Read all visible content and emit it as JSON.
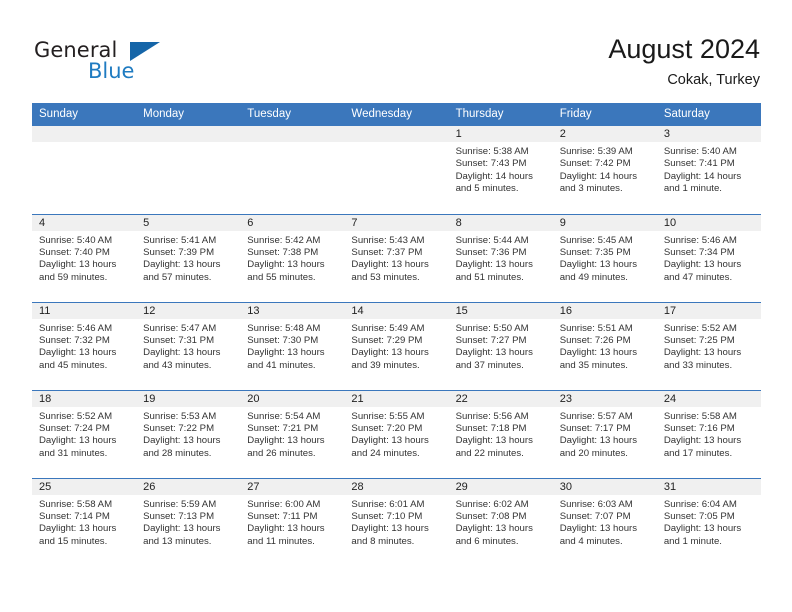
{
  "brand": {
    "name_primary": "General",
    "name_secondary": "Blue",
    "triangle_color": "#1565a8",
    "blue_color": "#1f7bc1"
  },
  "header": {
    "title": "August 2024",
    "subtitle": "Cokak, Turkey",
    "header_bg": "#3b77bc",
    "daynum_bg": "#f0f0f0"
  },
  "weekday_headers": [
    "Sunday",
    "Monday",
    "Tuesday",
    "Wednesday",
    "Thursday",
    "Friday",
    "Saturday"
  ],
  "labels": {
    "sunrise_prefix": "Sunrise:",
    "sunset_prefix": "Sunset:",
    "daylight_prefix": "Daylight:"
  },
  "weeks": [
    [
      {
        "day": "",
        "empty": true,
        "sunrise": "",
        "sunset": "",
        "daylight": ""
      },
      {
        "day": "",
        "empty": true,
        "sunrise": "",
        "sunset": "",
        "daylight": ""
      },
      {
        "day": "",
        "empty": true,
        "sunrise": "",
        "sunset": "",
        "daylight": ""
      },
      {
        "day": "",
        "empty": true,
        "sunrise": "",
        "sunset": "",
        "daylight": ""
      },
      {
        "day": "1",
        "empty": false,
        "sunrise": "Sunrise: 5:38 AM",
        "sunset": "Sunset: 7:43 PM",
        "daylight": "Daylight: 14 hours and 5 minutes."
      },
      {
        "day": "2",
        "empty": false,
        "sunrise": "Sunrise: 5:39 AM",
        "sunset": "Sunset: 7:42 PM",
        "daylight": "Daylight: 14 hours and 3 minutes."
      },
      {
        "day": "3",
        "empty": false,
        "sunrise": "Sunrise: 5:40 AM",
        "sunset": "Sunset: 7:41 PM",
        "daylight": "Daylight: 14 hours and 1 minute."
      }
    ],
    [
      {
        "day": "4",
        "empty": false,
        "sunrise": "Sunrise: 5:40 AM",
        "sunset": "Sunset: 7:40 PM",
        "daylight": "Daylight: 13 hours and 59 minutes."
      },
      {
        "day": "5",
        "empty": false,
        "sunrise": "Sunrise: 5:41 AM",
        "sunset": "Sunset: 7:39 PM",
        "daylight": "Daylight: 13 hours and 57 minutes."
      },
      {
        "day": "6",
        "empty": false,
        "sunrise": "Sunrise: 5:42 AM",
        "sunset": "Sunset: 7:38 PM",
        "daylight": "Daylight: 13 hours and 55 minutes."
      },
      {
        "day": "7",
        "empty": false,
        "sunrise": "Sunrise: 5:43 AM",
        "sunset": "Sunset: 7:37 PM",
        "daylight": "Daylight: 13 hours and 53 minutes."
      },
      {
        "day": "8",
        "empty": false,
        "sunrise": "Sunrise: 5:44 AM",
        "sunset": "Sunset: 7:36 PM",
        "daylight": "Daylight: 13 hours and 51 minutes."
      },
      {
        "day": "9",
        "empty": false,
        "sunrise": "Sunrise: 5:45 AM",
        "sunset": "Sunset: 7:35 PM",
        "daylight": "Daylight: 13 hours and 49 minutes."
      },
      {
        "day": "10",
        "empty": false,
        "sunrise": "Sunrise: 5:46 AM",
        "sunset": "Sunset: 7:34 PM",
        "daylight": "Daylight: 13 hours and 47 minutes."
      }
    ],
    [
      {
        "day": "11",
        "empty": false,
        "sunrise": "Sunrise: 5:46 AM",
        "sunset": "Sunset: 7:32 PM",
        "daylight": "Daylight: 13 hours and 45 minutes."
      },
      {
        "day": "12",
        "empty": false,
        "sunrise": "Sunrise: 5:47 AM",
        "sunset": "Sunset: 7:31 PM",
        "daylight": "Daylight: 13 hours and 43 minutes."
      },
      {
        "day": "13",
        "empty": false,
        "sunrise": "Sunrise: 5:48 AM",
        "sunset": "Sunset: 7:30 PM",
        "daylight": "Daylight: 13 hours and 41 minutes."
      },
      {
        "day": "14",
        "empty": false,
        "sunrise": "Sunrise: 5:49 AM",
        "sunset": "Sunset: 7:29 PM",
        "daylight": "Daylight: 13 hours and 39 minutes."
      },
      {
        "day": "15",
        "empty": false,
        "sunrise": "Sunrise: 5:50 AM",
        "sunset": "Sunset: 7:27 PM",
        "daylight": "Daylight: 13 hours and 37 minutes."
      },
      {
        "day": "16",
        "empty": false,
        "sunrise": "Sunrise: 5:51 AM",
        "sunset": "Sunset: 7:26 PM",
        "daylight": "Daylight: 13 hours and 35 minutes."
      },
      {
        "day": "17",
        "empty": false,
        "sunrise": "Sunrise: 5:52 AM",
        "sunset": "Sunset: 7:25 PM",
        "daylight": "Daylight: 13 hours and 33 minutes."
      }
    ],
    [
      {
        "day": "18",
        "empty": false,
        "sunrise": "Sunrise: 5:52 AM",
        "sunset": "Sunset: 7:24 PM",
        "daylight": "Daylight: 13 hours and 31 minutes."
      },
      {
        "day": "19",
        "empty": false,
        "sunrise": "Sunrise: 5:53 AM",
        "sunset": "Sunset: 7:22 PM",
        "daylight": "Daylight: 13 hours and 28 minutes."
      },
      {
        "day": "20",
        "empty": false,
        "sunrise": "Sunrise: 5:54 AM",
        "sunset": "Sunset: 7:21 PM",
        "daylight": "Daylight: 13 hours and 26 minutes."
      },
      {
        "day": "21",
        "empty": false,
        "sunrise": "Sunrise: 5:55 AM",
        "sunset": "Sunset: 7:20 PM",
        "daylight": "Daylight: 13 hours and 24 minutes."
      },
      {
        "day": "22",
        "empty": false,
        "sunrise": "Sunrise: 5:56 AM",
        "sunset": "Sunset: 7:18 PM",
        "daylight": "Daylight: 13 hours and 22 minutes."
      },
      {
        "day": "23",
        "empty": false,
        "sunrise": "Sunrise: 5:57 AM",
        "sunset": "Sunset: 7:17 PM",
        "daylight": "Daylight: 13 hours and 20 minutes."
      },
      {
        "day": "24",
        "empty": false,
        "sunrise": "Sunrise: 5:58 AM",
        "sunset": "Sunset: 7:16 PM",
        "daylight": "Daylight: 13 hours and 17 minutes."
      }
    ],
    [
      {
        "day": "25",
        "empty": false,
        "sunrise": "Sunrise: 5:58 AM",
        "sunset": "Sunset: 7:14 PM",
        "daylight": "Daylight: 13 hours and 15 minutes."
      },
      {
        "day": "26",
        "empty": false,
        "sunrise": "Sunrise: 5:59 AM",
        "sunset": "Sunset: 7:13 PM",
        "daylight": "Daylight: 13 hours and 13 minutes."
      },
      {
        "day": "27",
        "empty": false,
        "sunrise": "Sunrise: 6:00 AM",
        "sunset": "Sunset: 7:11 PM",
        "daylight": "Daylight: 13 hours and 11 minutes."
      },
      {
        "day": "28",
        "empty": false,
        "sunrise": "Sunrise: 6:01 AM",
        "sunset": "Sunset: 7:10 PM",
        "daylight": "Daylight: 13 hours and 8 minutes."
      },
      {
        "day": "29",
        "empty": false,
        "sunrise": "Sunrise: 6:02 AM",
        "sunset": "Sunset: 7:08 PM",
        "daylight": "Daylight: 13 hours and 6 minutes."
      },
      {
        "day": "30",
        "empty": false,
        "sunrise": "Sunrise: 6:03 AM",
        "sunset": "Sunset: 7:07 PM",
        "daylight": "Daylight: 13 hours and 4 minutes."
      },
      {
        "day": "31",
        "empty": false,
        "sunrise": "Sunrise: 6:04 AM",
        "sunset": "Sunset: 7:05 PM",
        "daylight": "Daylight: 13 hours and 1 minute."
      }
    ]
  ]
}
